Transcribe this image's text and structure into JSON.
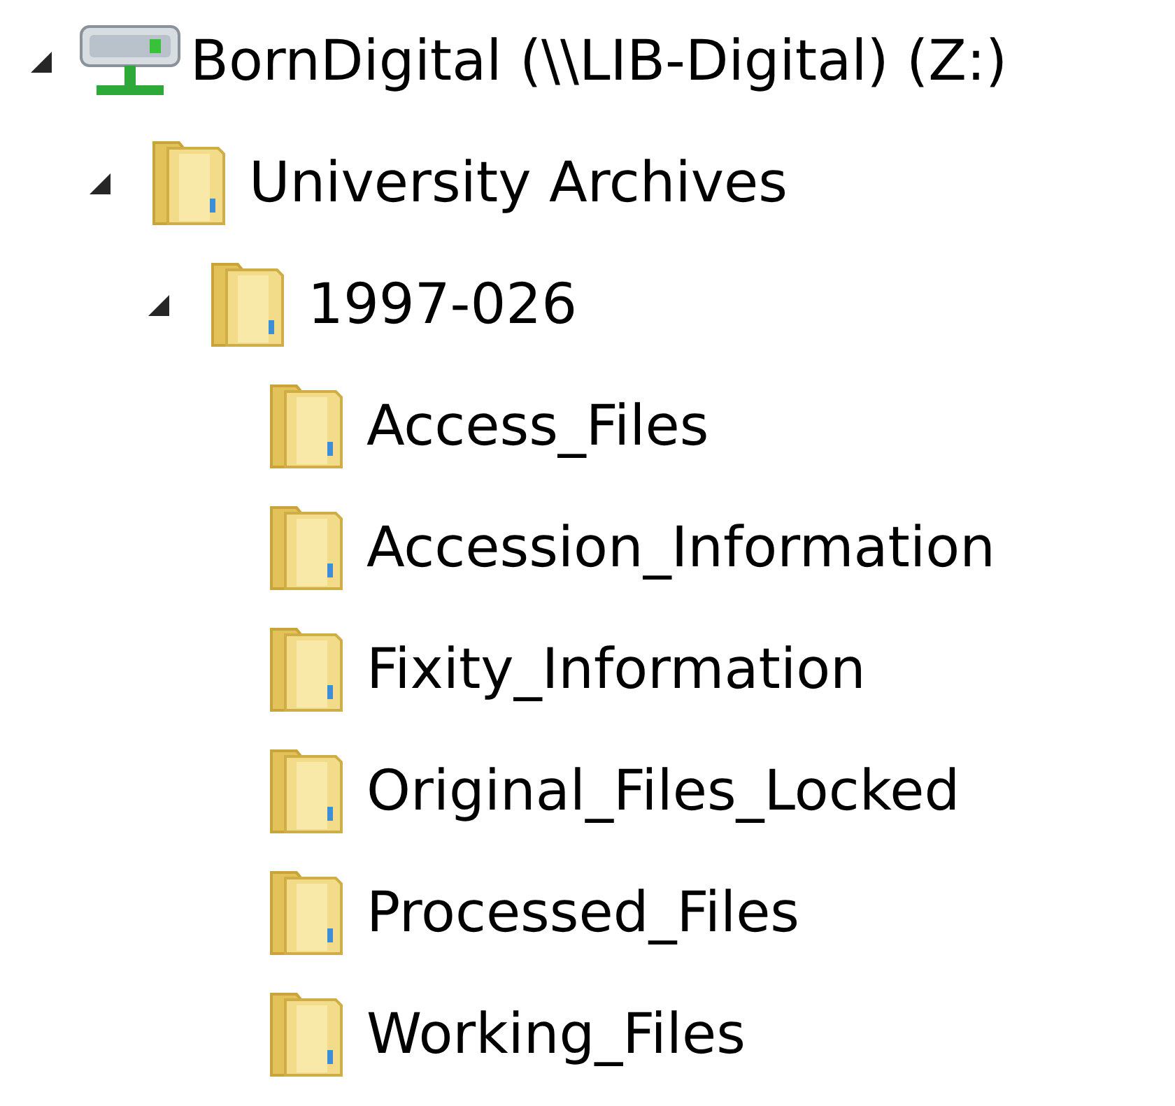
{
  "tree": [
    {
      "kind": "drive",
      "label": "BornDigital (\\\\LIB-Digital) (Z:)",
      "expanded": true,
      "children": [
        {
          "kind": "folder",
          "label": "University Archives",
          "expanded": true,
          "children": [
            {
              "kind": "folder",
              "label": "1997-026",
              "expanded": true,
              "children": [
                {
                  "kind": "folder",
                  "label": "Access_Files"
                },
                {
                  "kind": "folder",
                  "label": "Accession_Information"
                },
                {
                  "kind": "folder",
                  "label": "Fixity_Information"
                },
                {
                  "kind": "folder",
                  "label": "Original_Files_Locked"
                },
                {
                  "kind": "folder",
                  "label": "Processed_Files"
                },
                {
                  "kind": "folder",
                  "label": "Working_Files"
                }
              ]
            }
          ]
        }
      ]
    }
  ]
}
